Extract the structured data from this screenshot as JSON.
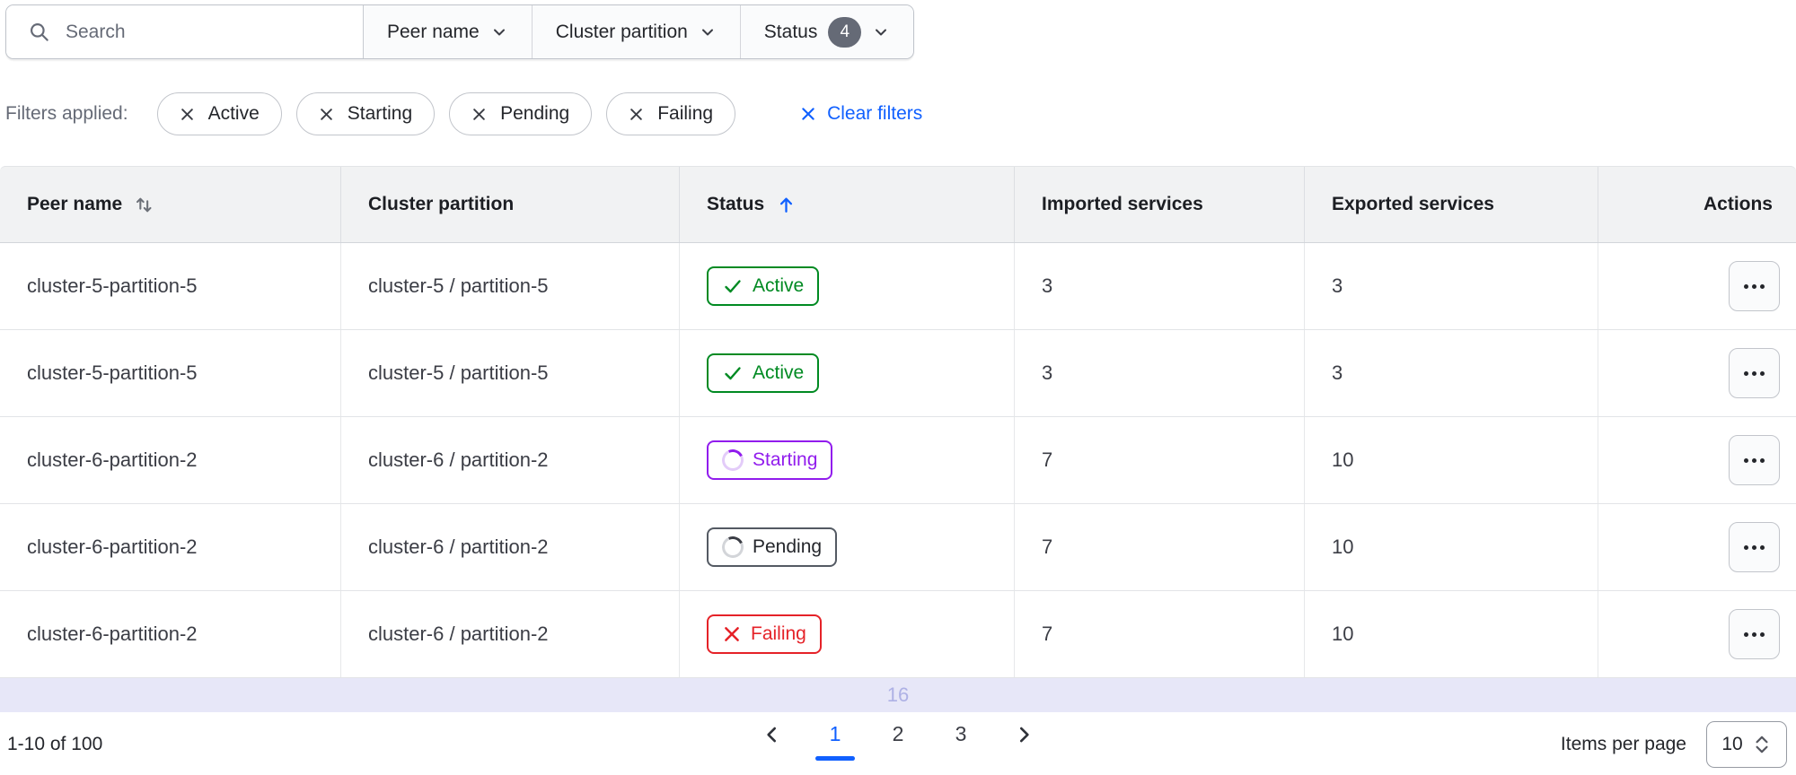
{
  "colors": {
    "action_blue": "#1060ff",
    "success_green": "#008a22",
    "highlight_purple": "#911ced",
    "critical_red": "#e52228",
    "neutral_text": "#3b3d45",
    "count_badge_bg": "#656a76",
    "overflow_bar_bg": "#e7e7f8",
    "overflow_bar_text": "#aeb1e5"
  },
  "toolbar": {
    "search_placeholder": "Search",
    "dropdowns": [
      {
        "label": "Peer name"
      },
      {
        "label": "Cluster partition"
      },
      {
        "label": "Status",
        "count": "4"
      }
    ]
  },
  "applied_filters": {
    "label": "Filters applied:",
    "chips": [
      "Active",
      "Starting",
      "Pending",
      "Failing"
    ],
    "clear_label": "Clear filters"
  },
  "table": {
    "columns": [
      {
        "label": "Peer name",
        "sort": "sortable"
      },
      {
        "label": "Cluster partition",
        "sort": "none"
      },
      {
        "label": "Status",
        "sort": "ascending"
      },
      {
        "label": "Imported services",
        "sort": "none"
      },
      {
        "label": "Exported services",
        "sort": "none"
      },
      {
        "label": "Actions",
        "sort": "none"
      }
    ],
    "rows": [
      {
        "peer": "cluster-5-partition-5",
        "partition": "cluster-5 / partition-5",
        "status": "Active",
        "imported": "3",
        "exported": "3"
      },
      {
        "peer": "cluster-5-partition-5",
        "partition": "cluster-5 / partition-5",
        "status": "Active",
        "imported": "3",
        "exported": "3"
      },
      {
        "peer": "cluster-6-partition-2",
        "partition": "cluster-6 / partition-2",
        "status": "Starting",
        "imported": "7",
        "exported": "10"
      },
      {
        "peer": "cluster-6-partition-2",
        "partition": "cluster-6 / partition-2",
        "status": "Pending",
        "imported": "7",
        "exported": "10"
      },
      {
        "peer": "cluster-6-partition-2",
        "partition": "cluster-6 / partition-2",
        "status": "Failing",
        "imported": "7",
        "exported": "10"
      }
    ],
    "overflow_indicator": "16"
  },
  "pagination": {
    "range_text": "1-10 of 100",
    "pages": [
      "1",
      "2",
      "3"
    ],
    "current_page": "1",
    "items_per_page_label": "Items per page",
    "items_per_page_value": "10"
  }
}
